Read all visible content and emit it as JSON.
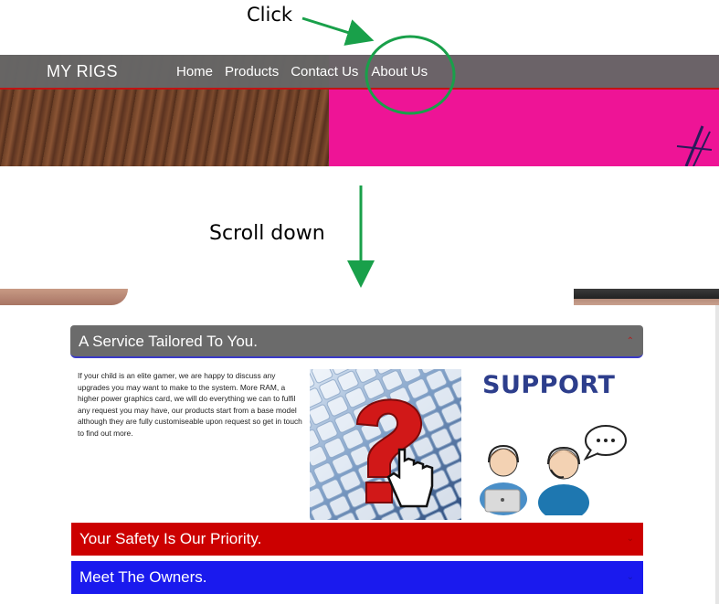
{
  "annotations": {
    "click_label": "Click",
    "scroll_label": "Scroll down",
    "arrow_color": "#19a04a"
  },
  "navbar": {
    "brand": "MY RIGS",
    "links": [
      "Home",
      "Products",
      "Contact Us",
      "About Us"
    ],
    "highlighted_link": "About Us",
    "background": "#666666",
    "accent_border": "#c21313"
  },
  "accordion": {
    "items": [
      {
        "title": "A Service Tailored To You.",
        "expanded": true,
        "color": "#6b6b6b",
        "body": "If your child is an elite gamer, we are happy to discuss any upgrades you may want to make to the system. More RAM, a higher power graphics card, we will do everything we can to fulfil any request you may have, our products start from a base model although they are fully customiseable upon request so get in touch to find out more."
      },
      {
        "title": "Your Safety Is Our Priority.",
        "expanded": false,
        "color": "#cc0000"
      },
      {
        "title": "Meet The Owners.",
        "expanded": false,
        "color": "#1a1aee"
      }
    ],
    "images": {
      "keyboard": {
        "icon": "keyboard-question-hand-icon"
      },
      "support": {
        "title": "SUPPORT",
        "icon": "support-agents-icon"
      }
    }
  }
}
